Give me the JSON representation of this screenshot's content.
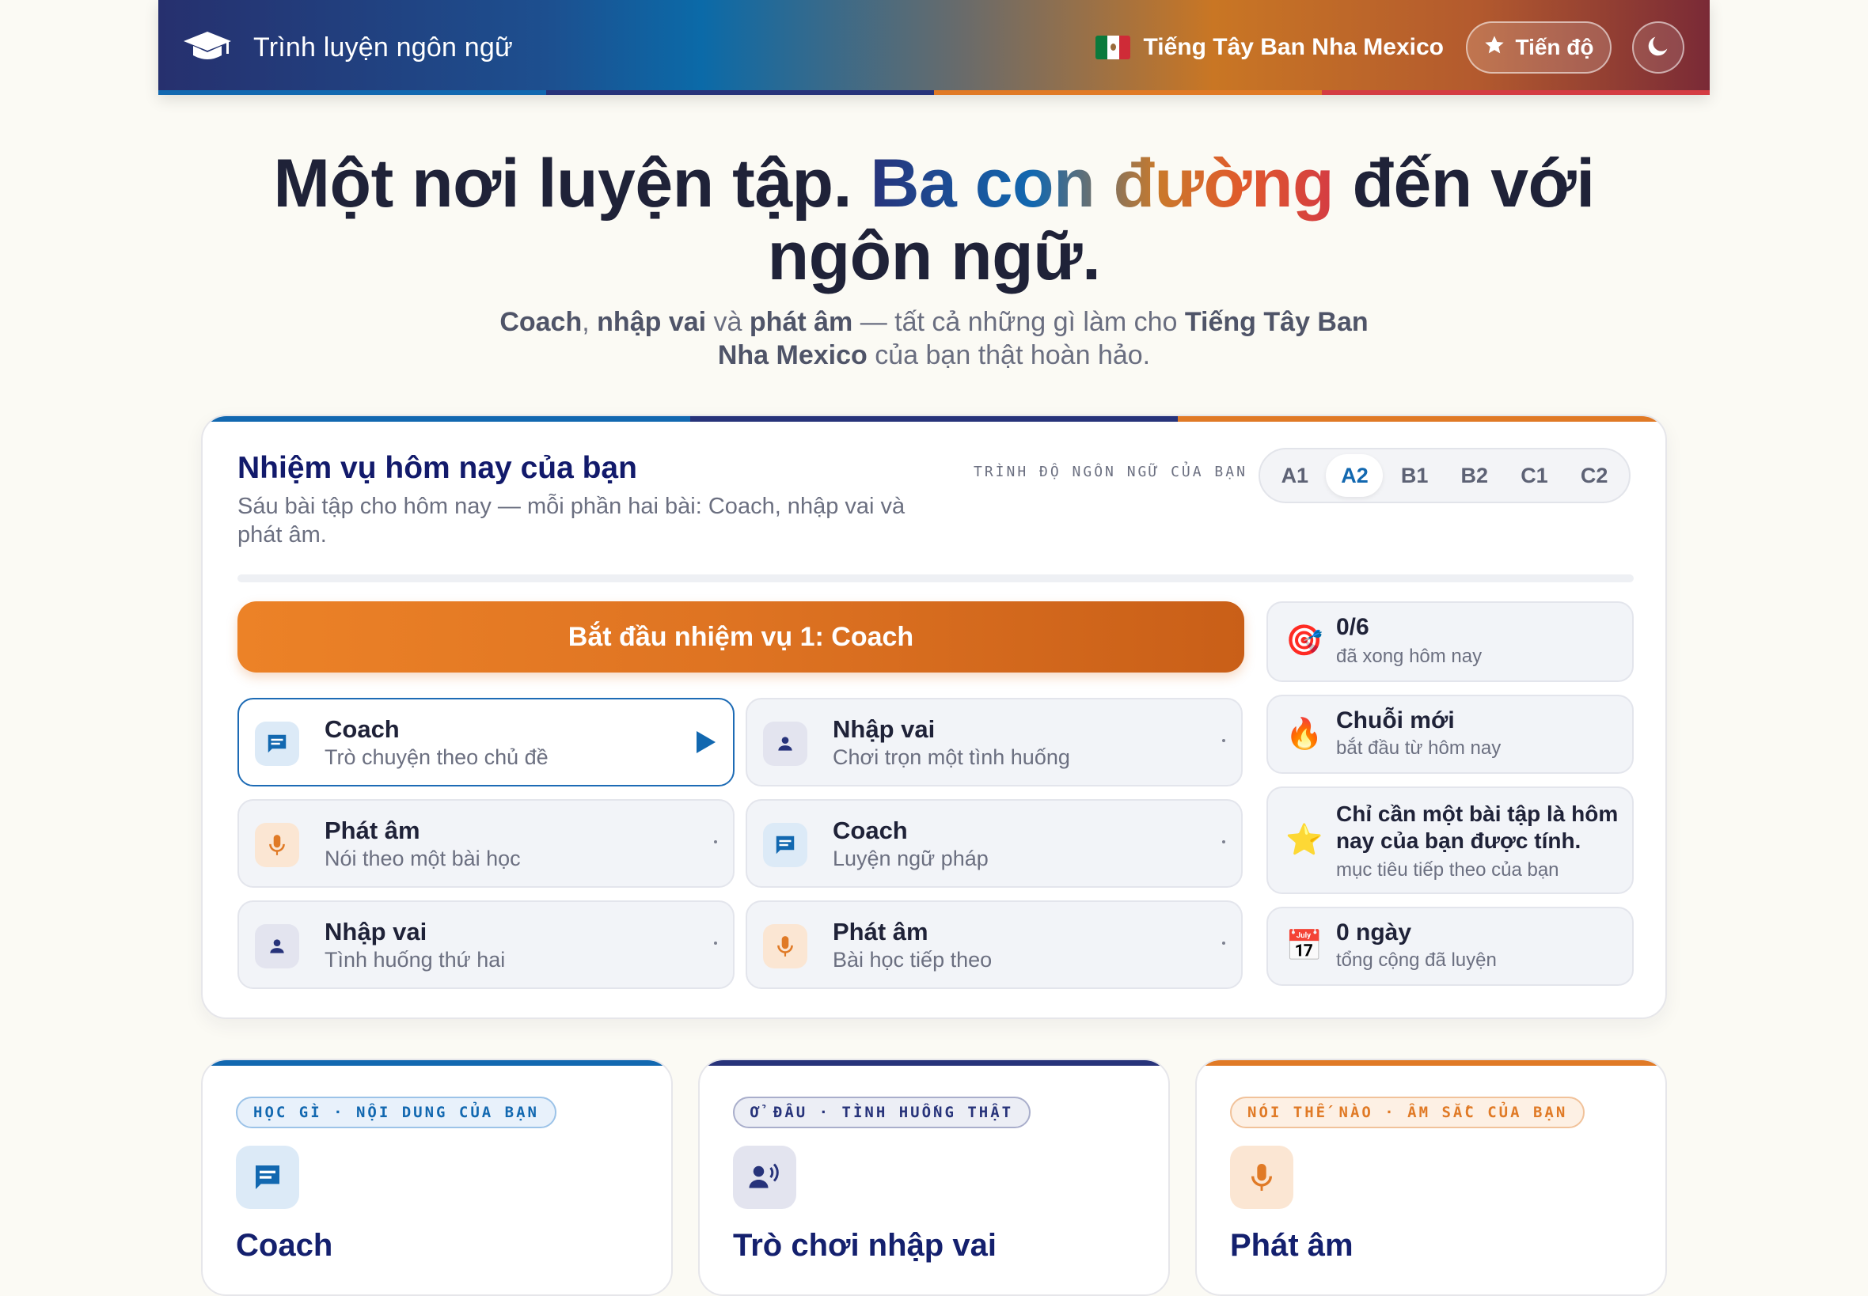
{
  "colors": {
    "navy": "#27337a",
    "blue": "#1268b0",
    "orange": "#e07a26",
    "red": "#d43c43",
    "text_dark": "#1f2238",
    "text_muted": "#6b6f80"
  },
  "header": {
    "brand_icon": "graduation-cap-icon",
    "brand": "Trình luyện ngôn ngữ",
    "language": "Tiếng Tây Ban Nha Mexico",
    "language_flag": "mexico-flag-icon",
    "progress_label": "Tiến độ",
    "progress_icon": "star-icon",
    "theme_icon": "moon-icon"
  },
  "hero": {
    "title_a": "Một nơi luyện tập.",
    "title_highlight": "Ba con đường",
    "title_b": "đến với ngôn ngữ.",
    "sub_b1": "Coach",
    "sub_t1": ", ",
    "sub_b2": "nhập vai",
    "sub_t2": " và ",
    "sub_b3": "phát âm",
    "sub_t3": " — tất cả những gì làm cho ",
    "sub_b4": "Tiếng Tây Ban Nha Mexico",
    "sub_t4": " của bạn thật hoàn hảo."
  },
  "mission": {
    "title": "Nhiệm vụ hôm nay của bạn",
    "description": "Sáu bài tập cho hôm nay — mỗi phần hai bài: Coach, nhập vai và phát âm.",
    "level_label": "TRÌNH ĐỘ NGÔN NGỮ CỦA BẠN",
    "levels": [
      "A1",
      "A2",
      "B1",
      "B2",
      "C1",
      "C2"
    ],
    "selected_level": "A2",
    "start_button": "Bắt đầu nhiệm vụ 1: Coach",
    "tasks": [
      {
        "title": "Coach",
        "subtitle": "Trò chuyện theo chủ đề",
        "icon": "chat-icon"
      },
      {
        "title": "Nhập vai",
        "subtitle": "Chơi trọn một tình huống",
        "icon": "person-icon"
      },
      {
        "title": "Phát âm",
        "subtitle": "Nói theo một bài học",
        "icon": "microphone-icon"
      },
      {
        "title": "Coach",
        "subtitle": "Luyện ngữ pháp",
        "icon": "chat-icon"
      },
      {
        "title": "Nhập vai",
        "subtitle": "Tình huống thứ hai",
        "icon": "person-icon"
      },
      {
        "title": "Phát âm",
        "subtitle": "Bài học tiếp theo",
        "icon": "microphone-icon"
      }
    ],
    "stats": [
      {
        "title": "0/6",
        "subtitle": "đã xong hôm nay",
        "icon": "target-icon",
        "glyph": "🎯"
      },
      {
        "title": "Chuỗi mới",
        "subtitle": "bắt đầu từ hôm nay",
        "icon": "fire-icon",
        "glyph": "🔥"
      },
      {
        "title": "Chỉ cần một bài tập là hôm nay của bạn được tính.",
        "subtitle": "mục tiêu tiếp theo của bạn",
        "icon": "star-icon",
        "glyph": "⭐"
      },
      {
        "title": "0 ngày",
        "subtitle": "tổng cộng đã luyện",
        "icon": "calendar-icon",
        "glyph": "📅"
      }
    ]
  },
  "paths": [
    {
      "tag": "HỌC GÌ · NỘI DUNG CỦA BẠN",
      "title": "Coach",
      "icon": "chat-icon"
    },
    {
      "tag": "Ở ĐÂU · TÌNH HUỐNG THẬT",
      "title": "Trò chơi nhập vai",
      "icon": "speaking-person-icon"
    },
    {
      "tag": "NÓI THẾ NÀO · ÂM SẮC CỦA BẠN",
      "title": "Phát âm",
      "icon": "microphone-icon"
    }
  ]
}
